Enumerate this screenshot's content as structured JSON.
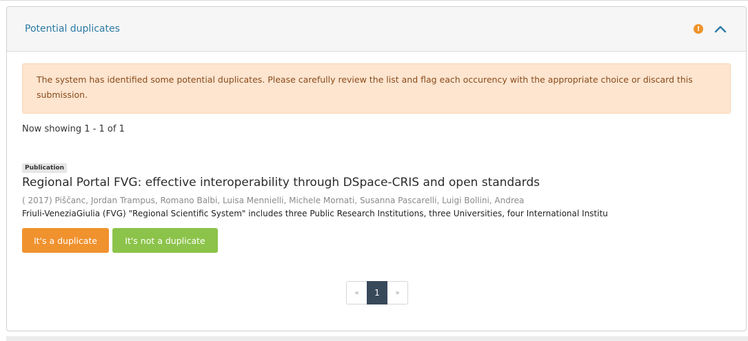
{
  "panel": {
    "title": "Potential duplicates",
    "warning_icon": "!",
    "alert": "The system has identified some potential duplicates. Please carefully review the list and flag each occurency with the appropriate choice or discard this submission.",
    "showing": "Now showing 1 - 1 of 1"
  },
  "item": {
    "type": "Publication",
    "title": "Regional Portal FVG: effective interoperability through DSpace-CRIS and open standards",
    "meta": "( 2017) Piščanc, Jordan Trampus, Romano Balbi, Luisa Mennielli, Michele Mornati, Susanna Pascarelli, Luigi Bollini, Andrea",
    "abstract": "Friuli-VeneziaGiulia (FVG) \"Regional Scientific System\" includes three Public Research Institutions, three Universities, four International Institu"
  },
  "actions": {
    "duplicate_label": "It's a duplicate",
    "not_duplicate_label": "It's not a duplicate"
  },
  "pagination": {
    "prev": "«",
    "current": "1",
    "next": "»"
  },
  "colors": {
    "accent": "#2b7aa3",
    "warning": "#f0932b",
    "duplicate_button": "#f0922e",
    "not_duplicate_button": "#8cc34a",
    "current_page": "#38495a"
  }
}
